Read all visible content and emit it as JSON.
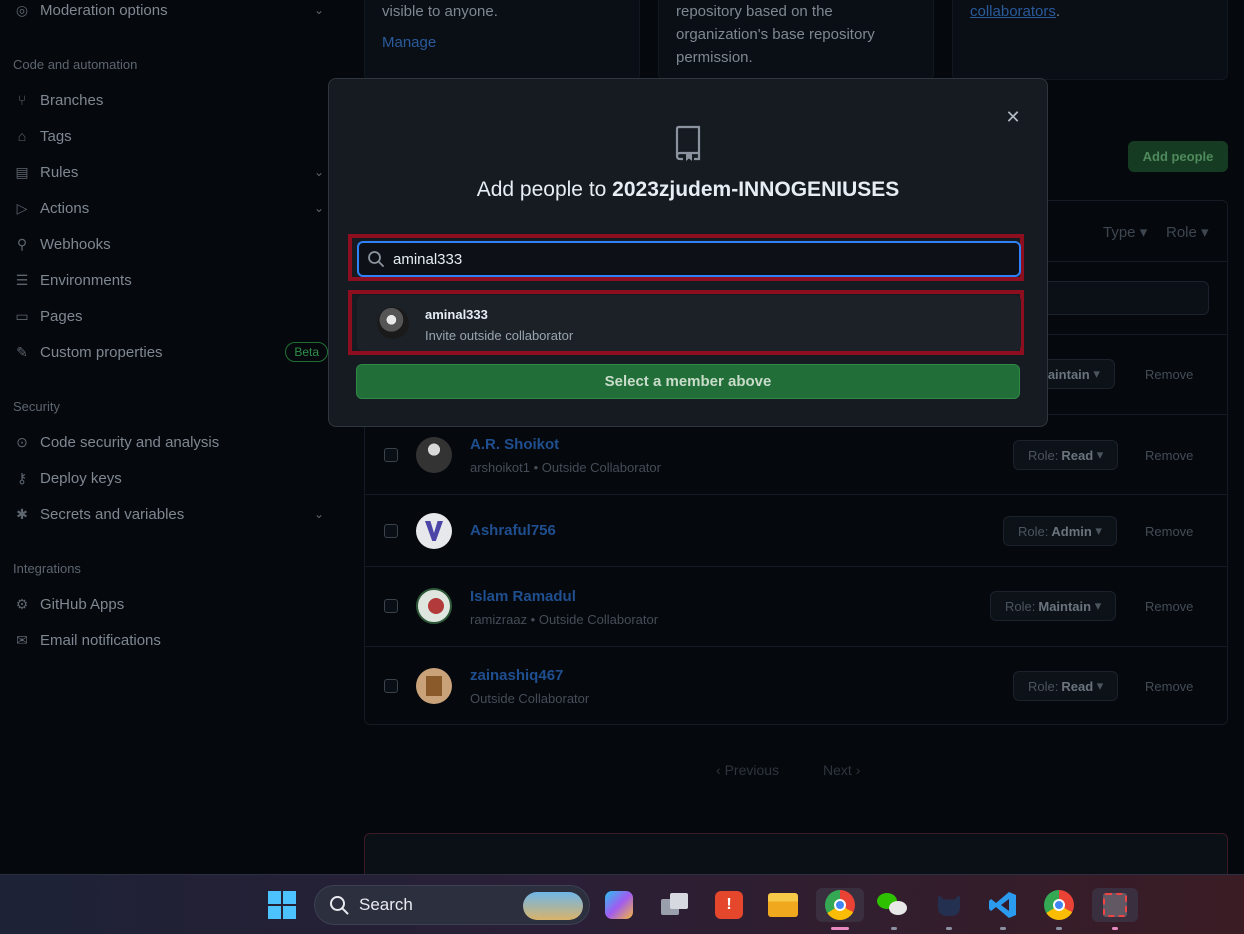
{
  "sidebar": {
    "top_item": "Moderation options",
    "sections": {
      "code": "Code and automation",
      "security": "Security",
      "integrations": "Integrations"
    },
    "code_items": [
      "Branches",
      "Tags",
      "Rules",
      "Actions",
      "Webhooks",
      "Environments",
      "Pages",
      "Custom properties"
    ],
    "security_items": [
      "Code security and analysis",
      "Deploy keys",
      "Secrets and variables"
    ],
    "integration_items": [
      "GitHub Apps",
      "Email notifications"
    ],
    "beta_badge": "Beta"
  },
  "background": {
    "card1_text": "visible to anyone.",
    "card1_link": "Manage",
    "card2_text": [
      "repository based on the",
      "organization's base repository",
      "permission."
    ],
    "card3_link": "collaborators",
    "card3_period": ".",
    "add_people_button": "Add people",
    "filters": {
      "type": "Type",
      "role": "Role"
    },
    "members": [
      {
        "name": "",
        "sub": "",
        "role_prefix": "",
        "role": "Maintain",
        "remove": "Remove"
      },
      {
        "name": "A.R. Shoikot",
        "sub": "arshoikot1 • Outside Collaborator",
        "role_prefix": "Role:",
        "role": "Read",
        "remove": "Remove"
      },
      {
        "name": "Ashraful756",
        "sub": "",
        "role_prefix": "Role:",
        "role": "Admin",
        "remove": "Remove"
      },
      {
        "name": "Islam Ramadul",
        "sub": "ramizraaz • Outside Collaborator",
        "role_prefix": "Role:",
        "role": "Maintain",
        "remove": "Remove"
      },
      {
        "name": "zainashiq467",
        "sub": "Outside Collaborator",
        "role_prefix": "Role:",
        "role": "Read",
        "remove": "Remove"
      }
    ],
    "pagination": {
      "previous": "Previous",
      "next": "Next"
    }
  },
  "modal": {
    "title_prefix": "Add people to",
    "repo_name": "2023zjudem-INNOGENIUSES",
    "search_value": "aminal333",
    "result": {
      "username": "aminal333",
      "subtitle": "Invite outside collaborator"
    },
    "select_button": "Select a member above"
  },
  "taskbar": {
    "search_label": "Search",
    "apps": [
      "windows-start",
      "copilot",
      "task-view",
      "app-red",
      "file-explorer",
      "chrome",
      "wechat",
      "cat-app",
      "vscode",
      "chrome-profile",
      "snipping-tool"
    ]
  },
  "colors": {
    "primary_button": "#216e39",
    "focus_ring": "#2f81f7",
    "highlight_box": "#8d0e1e",
    "modal_bg": "#161b22"
  }
}
